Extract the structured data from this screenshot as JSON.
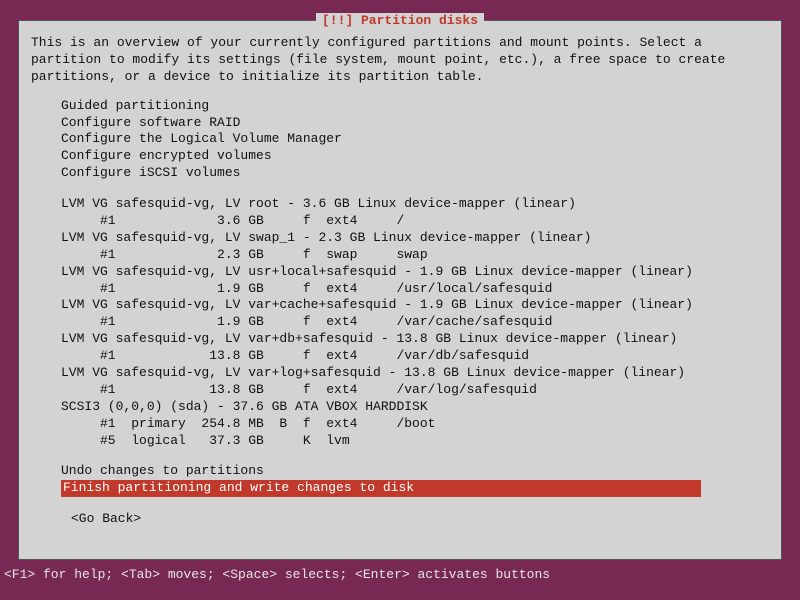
{
  "title": "[!!] Partition disks",
  "intro": "This is an overview of your currently configured partitions and mount points. Select a\npartition to modify its settings (file system, mount point, etc.), a free space to create\npartitions, or a device to initialize its partition table.",
  "config_menu": [
    "Guided partitioning",
    "Configure software RAID",
    "Configure the Logical Volume Manager",
    "Configure encrypted volumes",
    "Configure iSCSI volumes"
  ],
  "partitions": [
    "LVM VG safesquid-vg, LV root - 3.6 GB Linux device-mapper (linear)",
    "     #1             3.6 GB     f  ext4     /",
    "LVM VG safesquid-vg, LV swap_1 - 2.3 GB Linux device-mapper (linear)",
    "     #1             2.3 GB     f  swap     swap",
    "LVM VG safesquid-vg, LV usr+local+safesquid - 1.9 GB Linux device-mapper (linear)",
    "     #1             1.9 GB     f  ext4     /usr/local/safesquid",
    "LVM VG safesquid-vg, LV var+cache+safesquid - 1.9 GB Linux device-mapper (linear)",
    "     #1             1.9 GB     f  ext4     /var/cache/safesquid",
    "LVM VG safesquid-vg, LV var+db+safesquid - 13.8 GB Linux device-mapper (linear)",
    "     #1            13.8 GB     f  ext4     /var/db/safesquid",
    "LVM VG safesquid-vg, LV var+log+safesquid - 13.8 GB Linux device-mapper (linear)",
    "     #1            13.8 GB     f  ext4     /var/log/safesquid",
    "SCSI3 (0,0,0) (sda) - 37.6 GB ATA VBOX HARDDISK",
    "     #1  primary  254.8 MB  B  f  ext4     /boot",
    "     #5  logical   37.3 GB     K  lvm"
  ],
  "actions": {
    "undo": "Undo changes to partitions",
    "finish": "Finish partitioning and write changes to disk"
  },
  "goback": "<Go Back>",
  "footer": "<F1> for help; <Tab> moves; <Space> selects; <Enter> activates buttons"
}
